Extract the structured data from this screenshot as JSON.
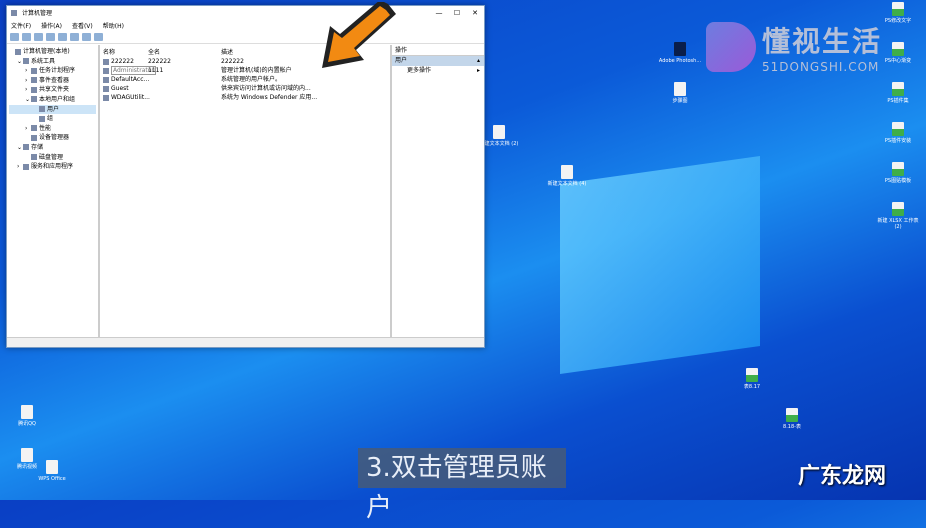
{
  "window": {
    "title": "计算机管理",
    "controls": [
      "—",
      "☐",
      "✕"
    ]
  },
  "menu": [
    "文件(F)",
    "操作(A)",
    "查看(V)",
    "帮助(H)"
  ],
  "tree": [
    {
      "label": "计算机管理(本地)",
      "indent": 0,
      "arrow": ""
    },
    {
      "label": "系统工具",
      "indent": 1,
      "arrow": "⌄"
    },
    {
      "label": "任务计划程序",
      "indent": 2,
      "arrow": "›"
    },
    {
      "label": "事件查看器",
      "indent": 2,
      "arrow": "›"
    },
    {
      "label": "共享文件夹",
      "indent": 2,
      "arrow": "›"
    },
    {
      "label": "本地用户和组",
      "indent": 2,
      "arrow": "⌄"
    },
    {
      "label": "用户",
      "indent": 3,
      "arrow": "",
      "selected": true
    },
    {
      "label": "组",
      "indent": 3,
      "arrow": ""
    },
    {
      "label": "性能",
      "indent": 2,
      "arrow": "›"
    },
    {
      "label": "设备管理器",
      "indent": 2,
      "arrow": ""
    },
    {
      "label": "存储",
      "indent": 1,
      "arrow": "⌄"
    },
    {
      "label": "磁盘管理",
      "indent": 2,
      "arrow": ""
    },
    {
      "label": "服务和应用程序",
      "indent": 1,
      "arrow": "›"
    }
  ],
  "list": {
    "headers": [
      "名称",
      "全名",
      "描述"
    ],
    "rows": [
      [
        "222222",
        "222222",
        "222222"
      ],
      [
        "Administrator",
        "1111",
        "管理计算机(域)的内置帐户"
      ],
      [
        "DefaultAcc...",
        "",
        "系统管理的用户帐户。"
      ],
      [
        "Guest",
        "",
        "供来宾访问计算机或访问域的内..."
      ],
      [
        "WDAGUtilit...",
        "",
        "系统为 Windows Defender 应用..."
      ]
    ]
  },
  "actions": {
    "header": "操作",
    "section": "用户",
    "item": "更多操作"
  },
  "desktop_icons": [
    {
      "label": "Adobe Photosh...",
      "type": "ps"
    },
    {
      "label": "步骤图",
      "type": "f"
    },
    {
      "label": "PS修改文字",
      "type": "x"
    },
    {
      "label": "PS中心渐变",
      "type": "x"
    },
    {
      "label": "PS插件集",
      "type": "x"
    },
    {
      "label": "PS插件安装",
      "type": "x"
    },
    {
      "label": "PS图贴模板",
      "type": "x"
    },
    {
      "label": "新建 XLSX 工作表 (2)",
      "type": "x"
    },
    {
      "label": "新建文本文档 (2)",
      "type": "f"
    },
    {
      "label": "新建文本文档 (4)",
      "type": "f"
    },
    {
      "label": "表8.17",
      "type": "x"
    },
    {
      "label": "8.18-表",
      "type": "x"
    },
    {
      "label": "WPS Office",
      "type": "f"
    },
    {
      "label": "腾讯QQ",
      "type": "f"
    },
    {
      "label": "腾讯视频",
      "type": "f"
    }
  ],
  "logo": {
    "name": "懂视生活",
    "site": "51DONGSHI.COM"
  },
  "subtitle": "3.双击管理员账户",
  "watermark": "广东龙网"
}
